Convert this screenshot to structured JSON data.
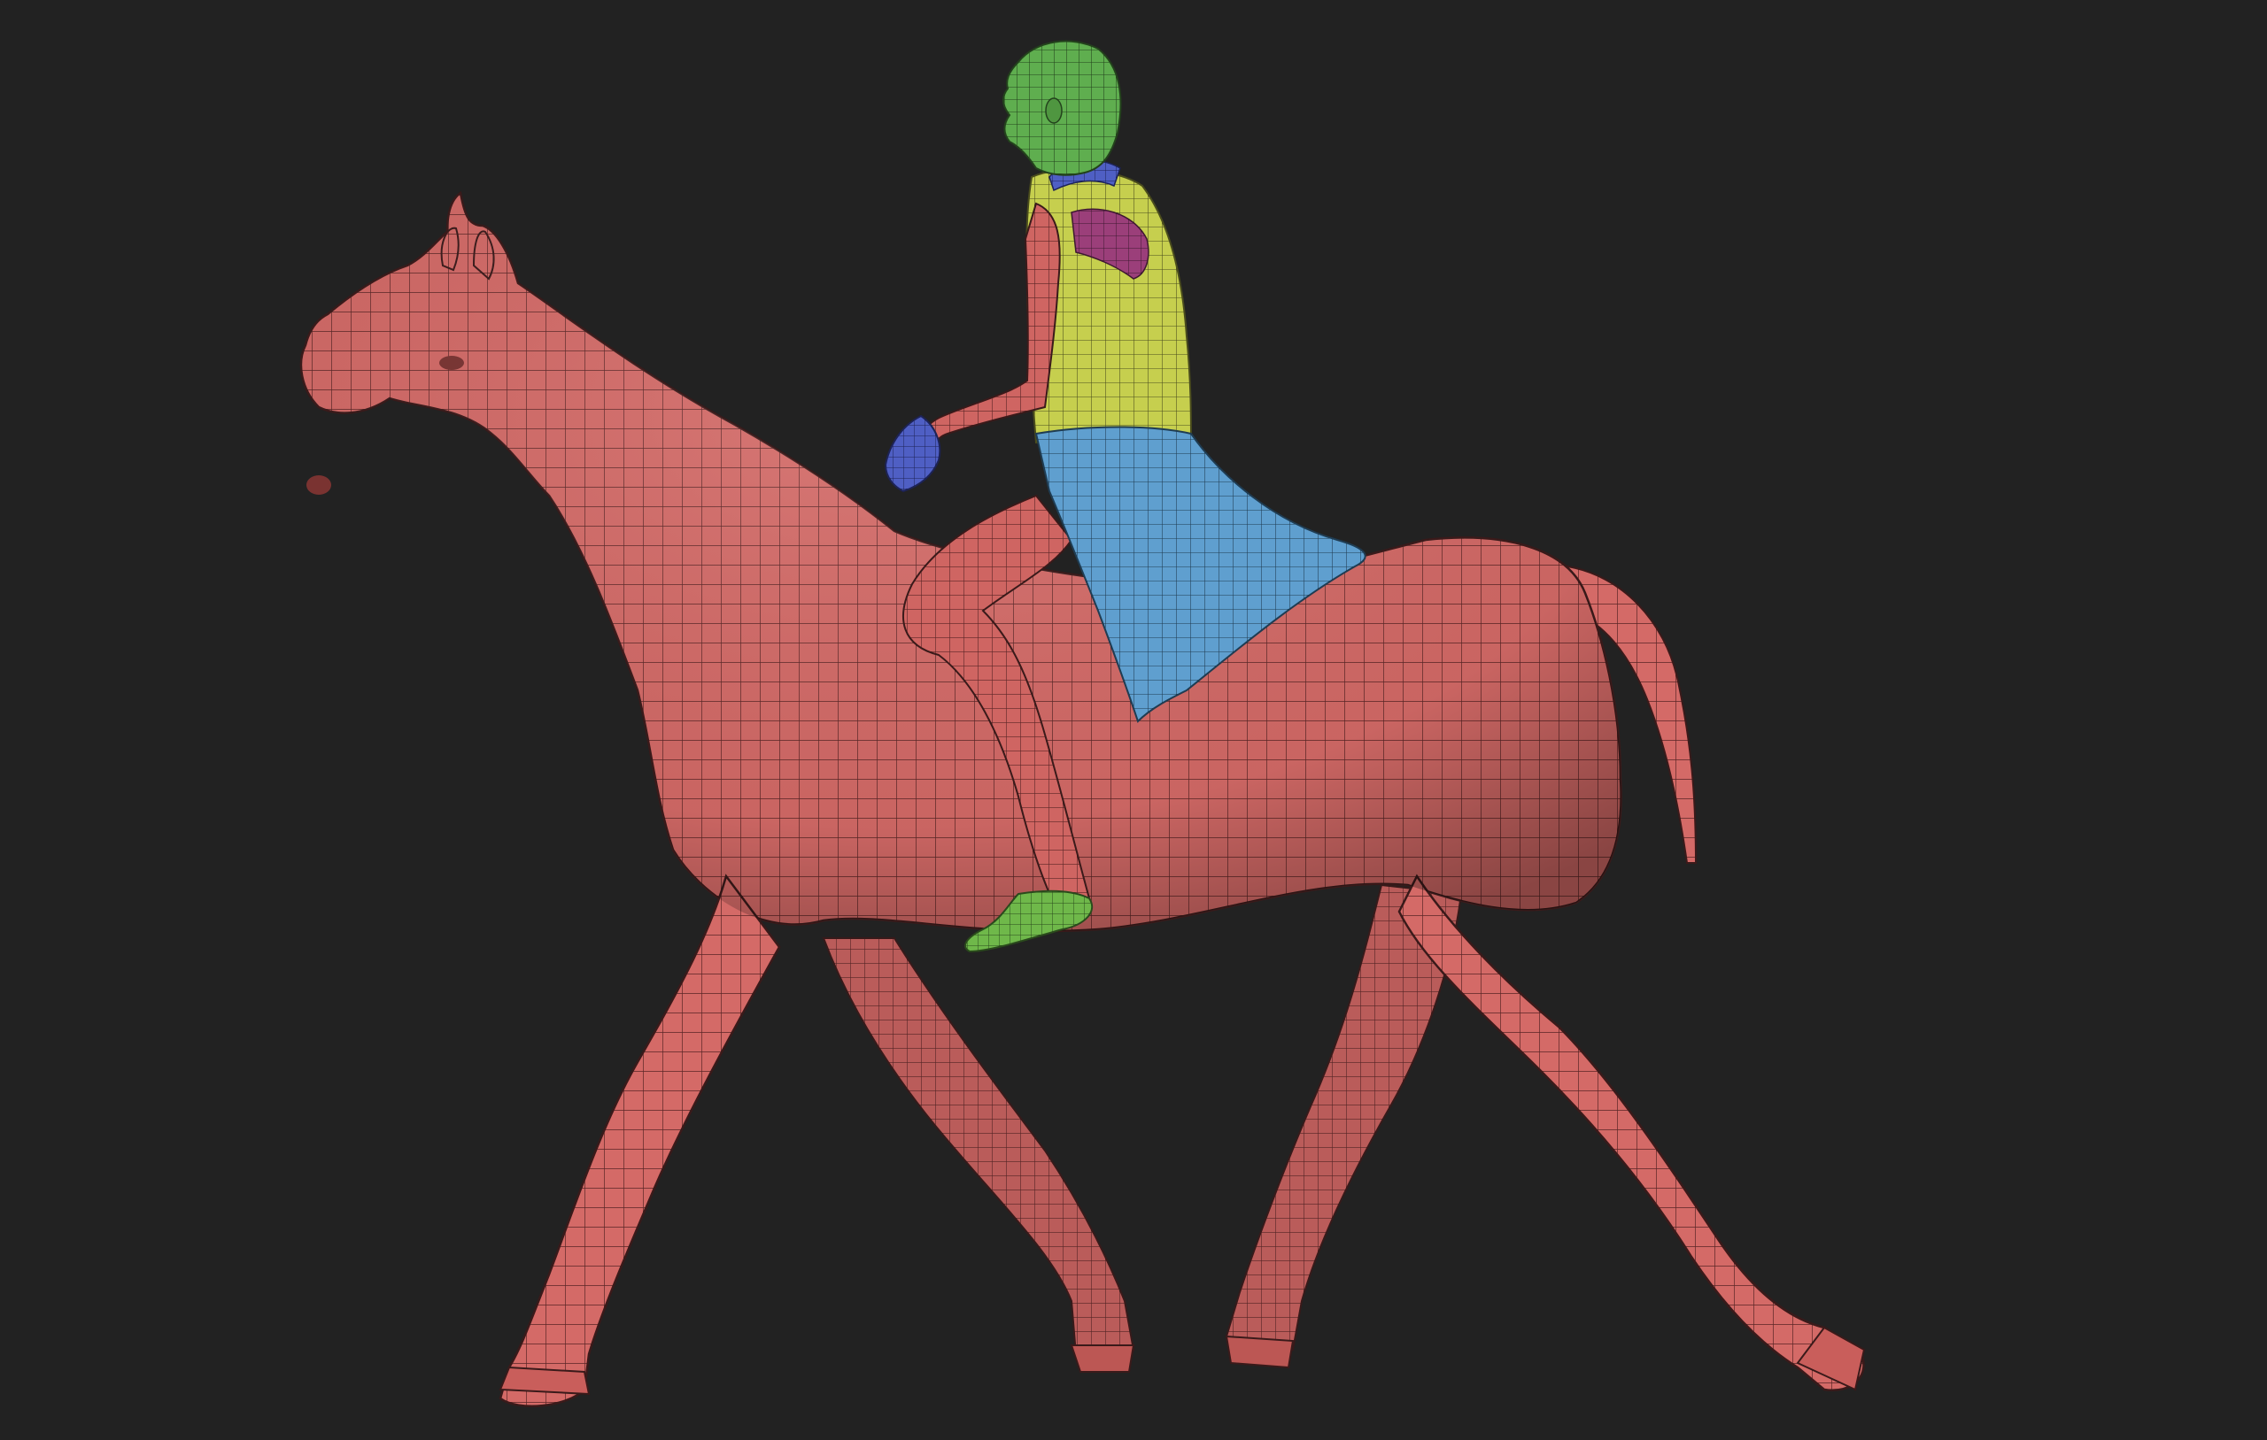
{
  "colors": {
    "background": "#222222",
    "horse_body": "#d46a67",
    "horse_dark": "#9a4644",
    "rider_skin": "#d46a67",
    "head_polygroup": "#5fae4f",
    "vest_polygroup": "#c6cf4e",
    "shoulder_polygroup": "#9b3f7a",
    "collar_polygroup": "#5b55c7",
    "skirt_polygroup": "#5f9fcf",
    "glove_polygroup": "#4f5fc4",
    "foot_polygroup": "#6fb84a",
    "wire": "#3a1a1a"
  },
  "scene": {
    "subjects": [
      "horse-mesh",
      "rider-mesh"
    ]
  }
}
